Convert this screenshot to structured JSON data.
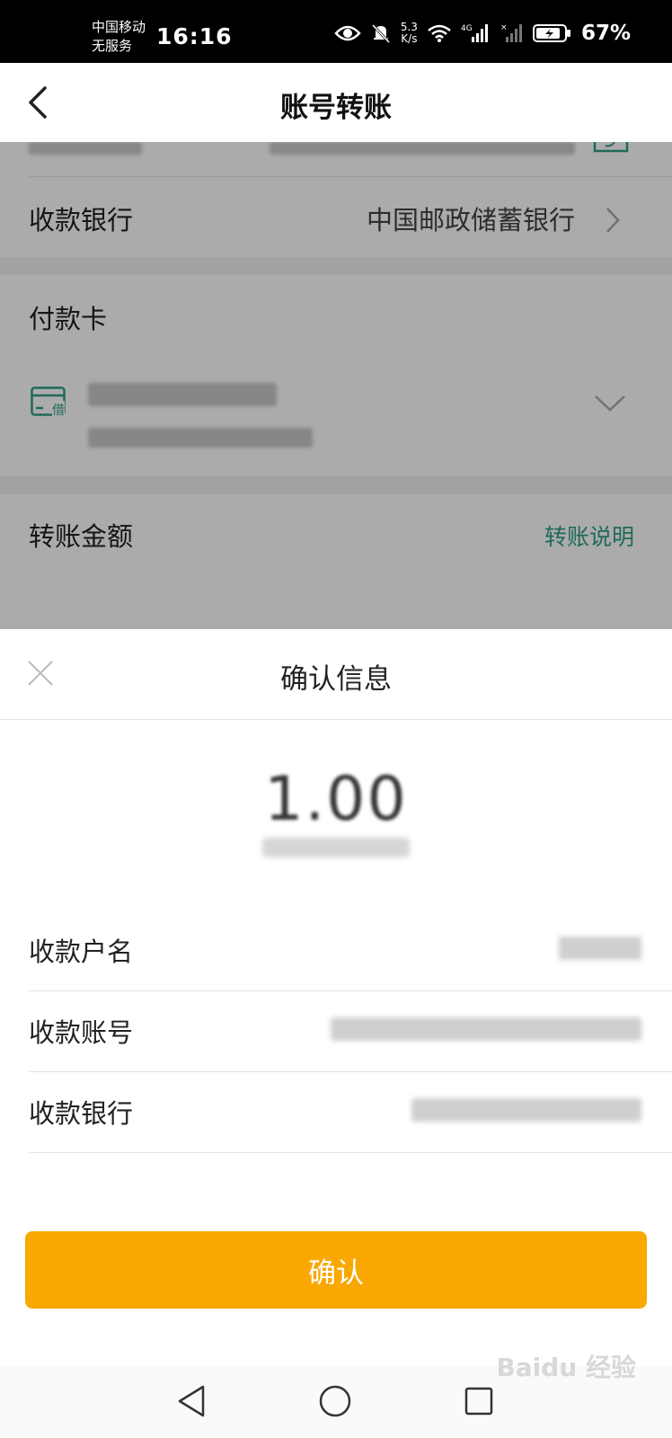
{
  "status_bar": {
    "carrier_line1": "中国移动",
    "carrier_line2": "无服务",
    "time": "16:16",
    "net_speed_value": "5.3",
    "net_speed_unit": "K/s",
    "battery": "67%"
  },
  "header": {
    "title": "账号转账"
  },
  "background": {
    "bank_label": "收款银行",
    "bank_value": "中国邮政储蓄银行",
    "card_section_label": "付款卡",
    "card_badge": "借",
    "amount_label": "转账金额",
    "amount_link": "转账说明"
  },
  "sheet": {
    "title": "确认信息",
    "amount": "1.00",
    "rows": [
      {
        "label": "收款户名"
      },
      {
        "label": "收款账号"
      },
      {
        "label": "收款银行"
      }
    ],
    "confirm_label": "确认"
  },
  "watermark": "Baidu 经验",
  "colors": {
    "accent_green": "#2f9e86",
    "confirm_orange": "#f8a800"
  }
}
